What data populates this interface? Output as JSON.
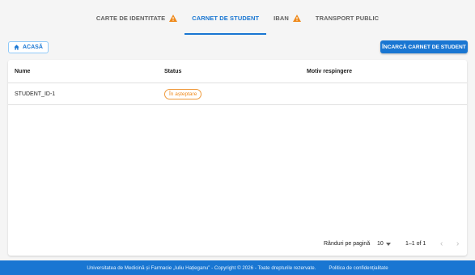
{
  "tabs": [
    {
      "label": "CARTE DE IDENTITATE",
      "warning": true
    },
    {
      "label": "CARNET DE STUDENT",
      "warning": false,
      "active": true
    },
    {
      "label": "IBAN",
      "warning": true
    },
    {
      "label": "TRANSPORT PUBLIC",
      "warning": false
    }
  ],
  "toolbar": {
    "home_label": "ACASĂ",
    "upload_label": "ÎNCARCĂ CARNET DE STUDENT"
  },
  "table": {
    "columns": [
      "Nume",
      "Status",
      "Motiv respingere"
    ],
    "rows": [
      {
        "name": "STUDENT_ID-1",
        "status": "În așteptare",
        "reason": ""
      }
    ]
  },
  "pagination": {
    "rows_per_page_label": "Rânduri pe pagină",
    "rows_per_page": "10",
    "range": "1–1 of 1"
  },
  "footer": {
    "copyright": "Universitatea de Medicină și Farmacie „Iuliu Hațieganu” - Copyright © 2026 - Toate drepturile rezervate.",
    "privacy_link": "Politica de confidențialitate"
  },
  "colors": {
    "primary": "#1976d2",
    "warning": "#ef8a1c",
    "background": "#f5f5f5"
  }
}
